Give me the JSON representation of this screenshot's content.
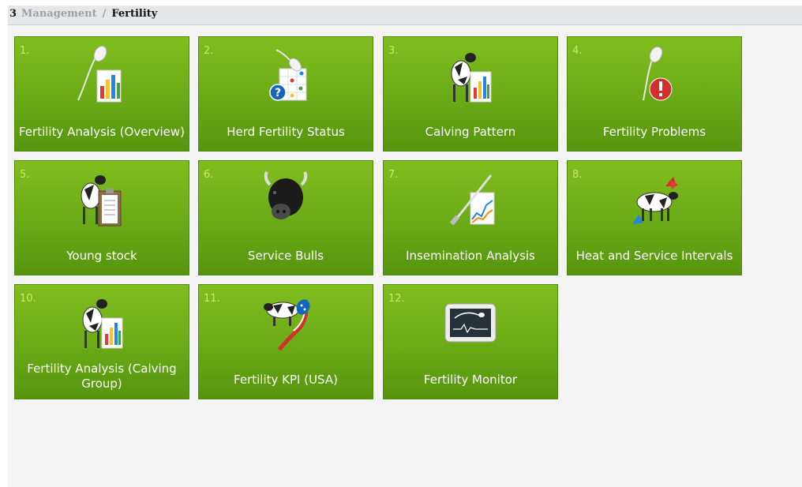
{
  "breadcrumb": {
    "number": "3",
    "parent": "Management",
    "separator": "/",
    "current": "Fertility"
  },
  "colors": {
    "tile_top": "#80bd1e",
    "tile_bottom": "#56940f",
    "tile_number": "#c8e86d",
    "breadcrumb_bar": "#e6e7e8"
  },
  "tiles": [
    {
      "number": "1.",
      "label": "Fertility Analysis (Overview)",
      "icon": "sperm-chart-icon"
    },
    {
      "number": "2.",
      "label": "Herd Fertility Status",
      "icon": "sperm-calendar-question-icon"
    },
    {
      "number": "3.",
      "label": "Calving Pattern",
      "icon": "cow-chart-icon"
    },
    {
      "number": "4.",
      "label": "Fertility Problems",
      "icon": "sperm-warning-icon"
    },
    {
      "number": "5.",
      "label": "Young stock",
      "icon": "cow-clipboard-icon"
    },
    {
      "number": "6.",
      "label": "Service Bulls",
      "icon": "bull-head-icon"
    },
    {
      "number": "7.",
      "label": "Insemination Analysis",
      "icon": "insemination-chart-icon"
    },
    {
      "number": "8.",
      "label": "Heat and Service Intervals",
      "icon": "cow-arrows-icon"
    },
    {
      "number": "10.",
      "label": "Fertility Analysis (Calving Group)",
      "icon": "cow-chart-icon"
    },
    {
      "number": "11.",
      "label": "Fertility KPI (USA)",
      "icon": "cow-usa-flag-icon"
    },
    {
      "number": "12.",
      "label": "Fertility Monitor",
      "icon": "monitor-icon"
    }
  ]
}
